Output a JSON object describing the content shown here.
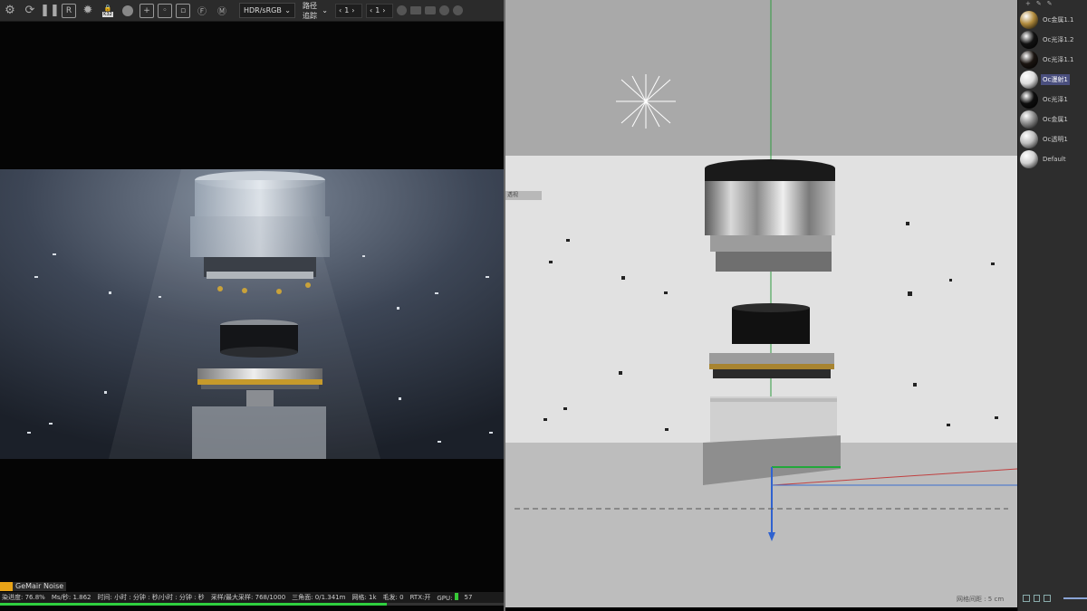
{
  "toolbar": {
    "icons": [
      "settings-gear-icon",
      "refresh-icon",
      "pause-icon",
      "region-r-icon",
      "lock-icon",
      "clay-sphere-icon"
    ],
    "badge": "K32",
    "color_space": "HDR/sRGB",
    "mode_select": "路径追踪",
    "field1": "1",
    "field2": "1"
  },
  "noise_label": "GeMair Noise",
  "status": {
    "progress": "染进度: 76.8%",
    "ms": "Ms/秒: 1.862",
    "time": "时间: 小时 : 分钟 : 秒/小时 : 分钟 : 秒",
    "samples": "采样/最大采样: 768/1000",
    "triangles": "三角面: 0/1.341m",
    "mesh": "网格: 1k",
    "hair": "毛发: 0",
    "rtx": "RTX:开",
    "gpu": "GPU:",
    "gpu_val": "57",
    "progress_fraction": 0.768
  },
  "viewport": {
    "tag": "透视",
    "grid_label": "网格间距 : 5 cm"
  },
  "materials": [
    {
      "name": "Oc金属1.1",
      "color": "#b08a3c"
    },
    {
      "name": "Oc光泽1.2",
      "color": "#111111"
    },
    {
      "name": "Oc光泽1.1",
      "color": "#1a1410"
    },
    {
      "name": "Oc漫射1",
      "color": "#dcdcdc"
    },
    {
      "name": "Oc光泽1",
      "color": "#0d0d0d"
    },
    {
      "name": "Oc金属1",
      "color": "#8a8a8a"
    },
    {
      "name": "Oc透明1",
      "color": "#bdbdbd"
    },
    {
      "name": "Default",
      "color": "#d0d0d0"
    }
  ]
}
